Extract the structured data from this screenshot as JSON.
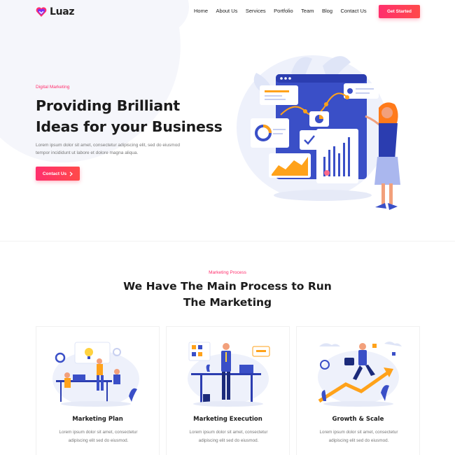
{
  "brand": {
    "name": "Luaz"
  },
  "nav": {
    "items": [
      "Home",
      "About Us",
      "Services",
      "Portfolio",
      "Team",
      "Blog",
      "Contact Us"
    ],
    "cta": "Get Started"
  },
  "hero": {
    "kicker": "Digital Marketing",
    "title_line1": "Providing Brilliant",
    "title_line2": "Ideas for your Business",
    "desc_line1": "Lorem ipsum dolor sit amet, consectetur adipiscing elit, sed do eiusmod",
    "desc_line2": "tempor incididunt ut labore et dolore magna aliqua.",
    "button": "Contact Us"
  },
  "process": {
    "kicker": "Marketing Process",
    "title_line1": "We Have The Main Process to Run",
    "title_line2": "The Marketing",
    "cards": [
      {
        "title": "Marketing Plan",
        "desc_line1": "Lorem ipsum dolor sit amet, consectetur",
        "desc_line2": "adipiscing elit sed do eiusmod."
      },
      {
        "title": "Marketing Execution",
        "desc_line1": "Lorem ipsum dolor sit amet, consectetur",
        "desc_line2": "adipiscing elit sed do eiusmod."
      },
      {
        "title": "Growth & Scale",
        "desc_line1": "Lorem ipsum dolor sit amet, consectetur",
        "desc_line2": "adipiscing elit sed do eiusmod."
      }
    ]
  },
  "colors": {
    "accent": "#ff2f6d",
    "accent2": "#ff4a4a",
    "illustration_blue": "#3a4fc7",
    "illustration_orange": "#ffa21a"
  },
  "icons": {
    "logo": "heart-logo-icon",
    "button_arrow": "chevron-right-icon"
  }
}
